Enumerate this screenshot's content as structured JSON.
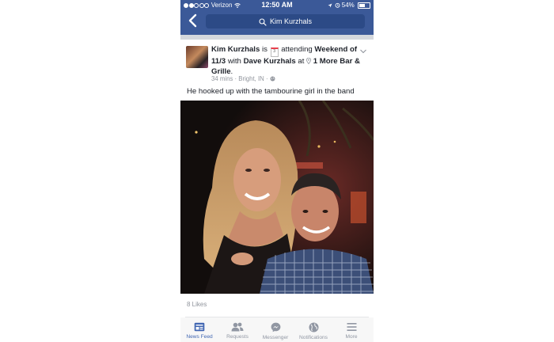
{
  "status_bar": {
    "carrier": "Verizon",
    "time": "12:50 AM",
    "battery": "54%"
  },
  "nav": {
    "search_text": "Kim Kurzhals"
  },
  "post": {
    "author": "Kim Kurzhals",
    "verb_is": "is",
    "calendar_day": "3",
    "verb_attending": "attending",
    "event": "Weekend of 11/3",
    "with_word": "with",
    "tagged": "Dave Kurzhals",
    "at_word": "at",
    "place": "1 More Bar & Grille",
    "period": ".",
    "time_ago": "34 mins",
    "location": "Bright, IN",
    "text": "He hooked up with the tambourine girl in the band",
    "likes": "8 Likes"
  },
  "tabs": [
    {
      "label": "News Feed",
      "icon": "news-feed-icon"
    },
    {
      "label": "Requests",
      "icon": "friend-requests-icon"
    },
    {
      "label": "Messenger",
      "icon": "messenger-icon"
    },
    {
      "label": "Notifications",
      "icon": "globe-icon"
    },
    {
      "label": "More",
      "icon": "hamburger-menu-icon"
    }
  ],
  "colors": {
    "brand": "#3b5998",
    "active_tab": "#4267b2",
    "muted_text": "#90949c"
  }
}
